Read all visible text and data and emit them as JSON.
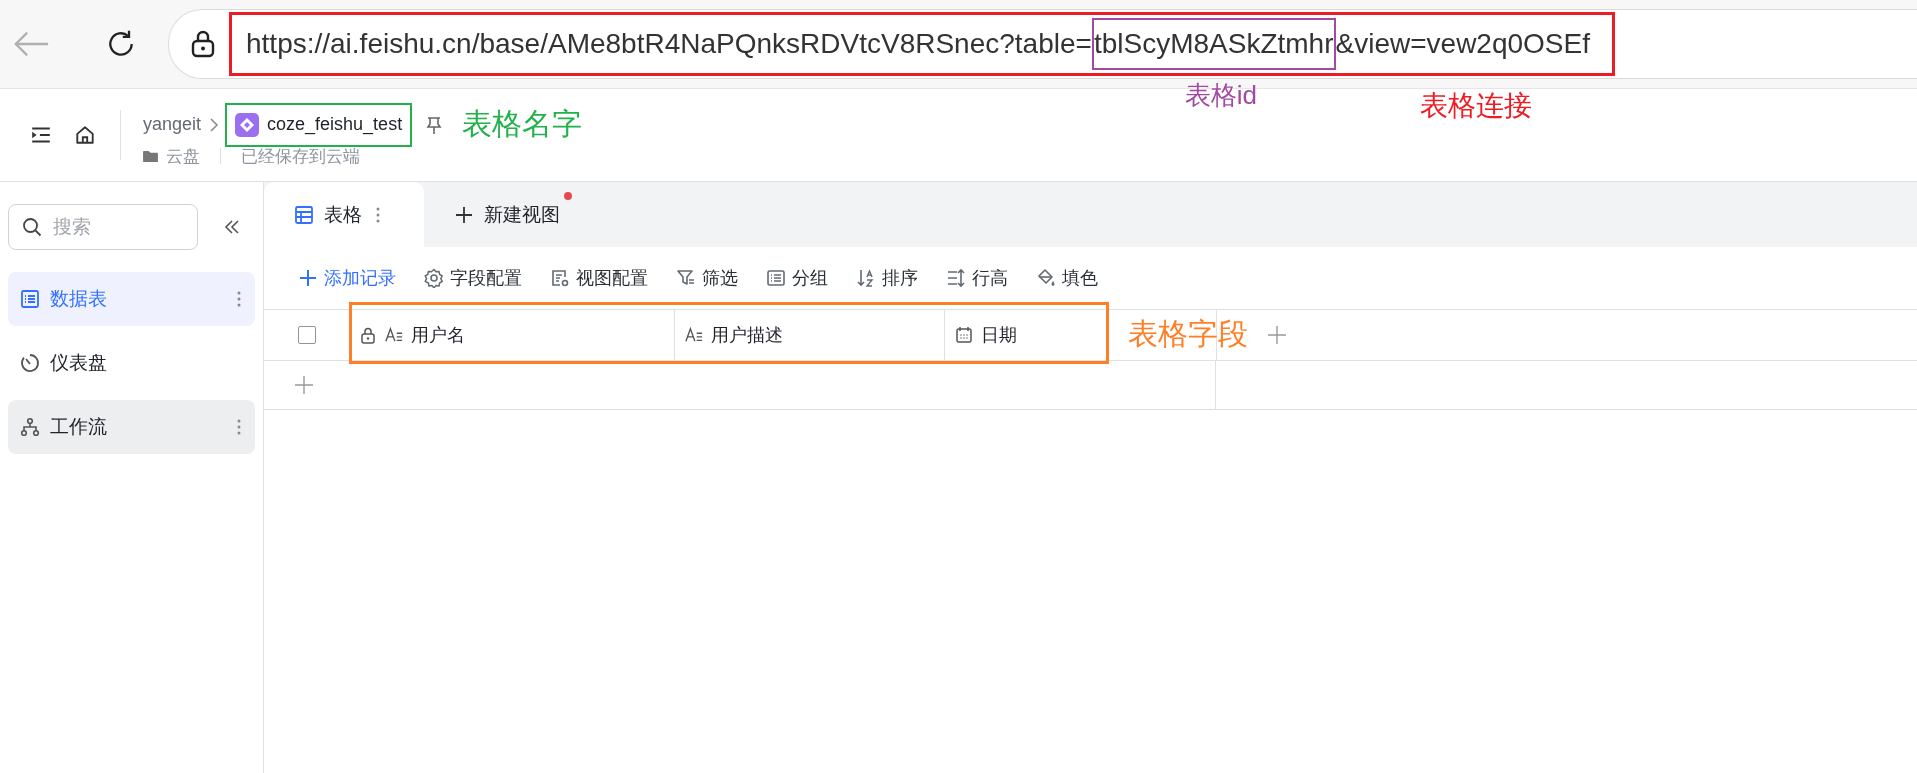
{
  "browser": {
    "url": {
      "prefix": "https://ai.feishu.cn/base/AMe8btR4NaPQnksRDVtcV8RSnec?table=",
      "highlight": "tblScyM8ASkZtmhr",
      "suffix": "&view=vew2q0OSEf"
    }
  },
  "annotations": [
    {
      "kind": "url",
      "label": "表格连接",
      "color": "#ed1c24"
    },
    {
      "kind": "id",
      "label": "表格id",
      "color": "#a349a4"
    },
    {
      "kind": "name",
      "label": "表格名字",
      "color": "#22b14c"
    },
    {
      "kind": "fields",
      "label": "表格字段",
      "color": "#ff7f27"
    }
  ],
  "header": {
    "workspace": "yangeit",
    "folder": "云盘",
    "status": "已经保存到云端",
    "doc_title": "coze_feishu_test"
  },
  "sidebar": {
    "search": {
      "placeholder": "搜索"
    },
    "items": [
      {
        "label": "数据表",
        "kind": "table",
        "selected": true,
        "hovered": false,
        "menu": true
      },
      {
        "label": "仪表盘",
        "kind": "dashboard",
        "selected": false,
        "hovered": false,
        "menu": false
      },
      {
        "label": "工作流",
        "kind": "workflow",
        "selected": false,
        "hovered": true,
        "menu": true
      }
    ]
  },
  "tabs": [
    {
      "label": "表格",
      "kind": "grid",
      "selected": true,
      "badge": false
    },
    {
      "label": "新建视图",
      "kind": "add",
      "selected": false,
      "badge": true
    }
  ],
  "toolbar": [
    {
      "label": "添加记录",
      "kind": "add"
    },
    {
      "label": "字段配置",
      "kind": "gear"
    },
    {
      "label": "视图配置",
      "kind": "view"
    },
    {
      "label": "筛选",
      "kind": "filter"
    },
    {
      "label": "分组",
      "kind": "group"
    },
    {
      "label": "排序",
      "kind": "sort"
    },
    {
      "label": "行高",
      "kind": "height"
    },
    {
      "label": "填色",
      "kind": "fill"
    }
  ],
  "table": {
    "select_all_checked": false,
    "columns": [
      {
        "label": "用户名",
        "kind": "text",
        "locked": true
      },
      {
        "label": "用户描述",
        "kind": "text",
        "locked": false
      },
      {
        "label": "日期",
        "kind": "date",
        "locked": false
      }
    ]
  }
}
